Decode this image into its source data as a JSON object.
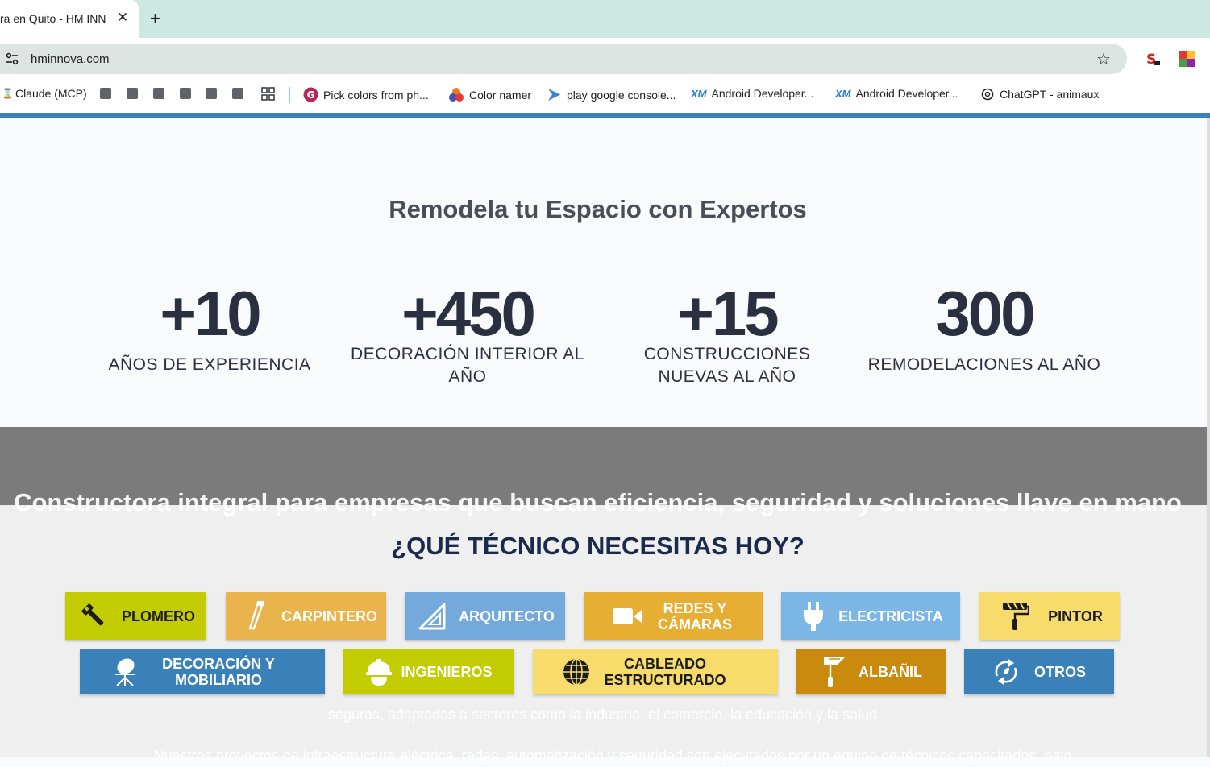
{
  "browser": {
    "tab_title": "ra en Quito - HM INNOVA",
    "tab_close": "✕",
    "new_tab": "+",
    "url": "hminnova.com",
    "bookmarks": [
      {
        "label": "Claude (MCP)"
      },
      {
        "label": "Pick colors from ph..."
      },
      {
        "label": "Color namer"
      },
      {
        "label": "play google console..."
      },
      {
        "label": "Android Developer..."
      },
      {
        "label": "Android Developer..."
      },
      {
        "label": "ChatGPT - animaux"
      }
    ]
  },
  "stats": {
    "title": "Remodela tu Espacio con Expertos",
    "items": [
      {
        "number": "+10",
        "label": "AÑOS DE EXPERIENCIA"
      },
      {
        "number": "+450",
        "label": "DECORACIÓN INTERIOR AL AÑO"
      },
      {
        "number": "+15",
        "label": "CONSTRUCCIONES NUEVAS AL AÑO"
      },
      {
        "number": "300",
        "label": "REMODELACIONES AL AÑO"
      }
    ]
  },
  "background_section": {
    "heading": "Constructora integral para empresas que buscan eficiencia, seguridad y soluciones llave en mano",
    "paragraph_1": "seguras, adaptadas a sectores como la industria, el comercio, la educación y la salud.",
    "paragraph_2": "Nuestros proyectos de infraestructura eléctrica, redes, automatización y seguridad son ejecutados por un equipo de técnicos capacitados, bajo"
  },
  "technicians": {
    "title": "¿QUÉ TÉCNICO NECESITAS HOY?",
    "buttons": [
      {
        "label": "PLOMERO",
        "icon": "wrench-icon",
        "color": "#c3cc00"
      },
      {
        "label": "CARPINTERO",
        "icon": "saw-icon",
        "color": "#e9b44c"
      },
      {
        "label": "ARQUITECTO",
        "icon": "set-square-icon",
        "color": "#74a9dc"
      },
      {
        "label": "REDES Y CÁMARAS",
        "icon": "video-camera-icon",
        "color": "#e7ae34"
      },
      {
        "label": "ELECTRICISTA",
        "icon": "plug-icon",
        "color": "#7cb6e4"
      },
      {
        "label": "PINTOR",
        "icon": "paint-roller-icon",
        "color": "#f7dc6c"
      },
      {
        "label": "DECORACIÓN Y MOBILIARIO",
        "icon": "chair-icon",
        "color": "#3a80b9"
      },
      {
        "label": "INGENIEROS",
        "icon": "hard-hat-icon",
        "color": "#c3cc00"
      },
      {
        "label": "CABLEADO ESTRUCTURADO",
        "icon": "globe-icon",
        "color": "#f7dc6c"
      },
      {
        "label": "ALBAÑIL",
        "icon": "trowel-icon",
        "color": "#c98a0e"
      },
      {
        "label": "OTROS",
        "icon": "recycle-icon",
        "color": "#3a80b9"
      }
    ]
  }
}
